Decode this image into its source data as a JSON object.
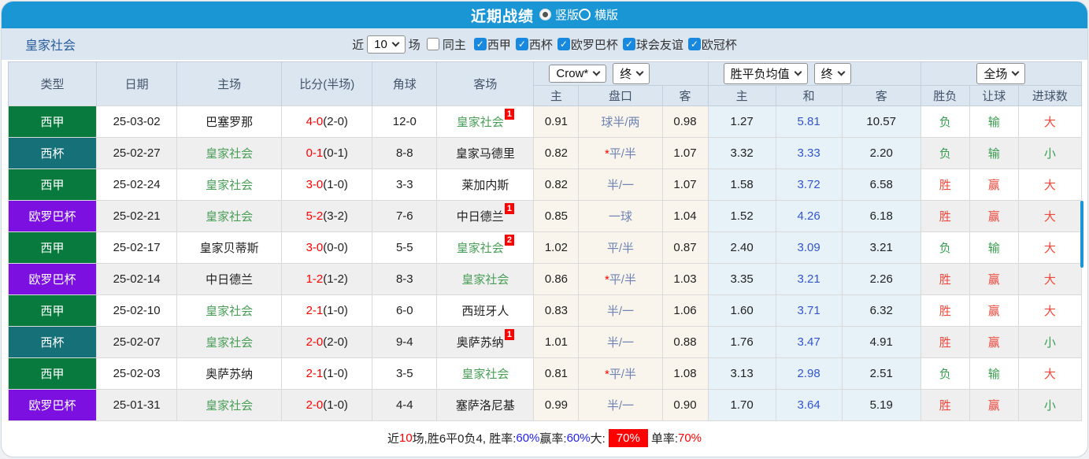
{
  "colors": {
    "accent": "#1b96d4",
    "check_blue": "#1989e0",
    "liga": "#087a3e",
    "copa": "#167078",
    "uefa": "#7b10e0",
    "team_green": "#4a9e58",
    "score_red": "#ff0000",
    "win_red": "#f0483c",
    "lose_green": "#3a9e50",
    "handicap_blue": "#6f83b5",
    "draw_blue": "#3355cc",
    "team_link_blue": "#2a5d9c",
    "footer_blue": "#2222ee"
  },
  "title_bar": {
    "title": "近期战绩",
    "radios": [
      {
        "label": "竖版",
        "checked": true
      },
      {
        "label": "横版",
        "checked": false
      }
    ]
  },
  "filter": {
    "team": "皇家社会",
    "near": "近",
    "count": "10",
    "matches": "场",
    "same_home": {
      "label": "同主",
      "checked": false
    },
    "leagues": [
      {
        "label": "西甲",
        "checked": true
      },
      {
        "label": "西杯",
        "checked": true
      },
      {
        "label": "欧罗巴杯",
        "checked": true
      },
      {
        "label": "球会友谊",
        "checked": true
      },
      {
        "label": "欧冠杯",
        "checked": true
      }
    ]
  },
  "table": {
    "selects": {
      "bookmaker": "Crow*",
      "final1": "终",
      "avg": "胜平负均值",
      "final2": "终",
      "scope": "全场"
    },
    "headers": {
      "type": "类型",
      "date": "日期",
      "home": "主场",
      "score": "比分(半场)",
      "corner": "角球",
      "away": "客场",
      "h": "主",
      "handicap": "盘口",
      "a": "客",
      "avg_h": "主",
      "avg_d": "和",
      "avg_a": "客",
      "wl": "胜负",
      "hcap": "让球",
      "goals": "进球数"
    },
    "rows": [
      {
        "league": "西甲",
        "lc": "liga",
        "date": "25-03-02",
        "home": "巴塞罗那",
        "ht": false,
        "score": "4-0",
        "half": "(2-0)",
        "corner": "12-0",
        "away": "皇家社会",
        "at": true,
        "sup": "1",
        "o1": "0.91",
        "star": false,
        "hcap": "球半/两",
        "o2": "0.98",
        "a1": "1.27",
        "a2": "5.81",
        "a3": "10.57",
        "r1": "负",
        "r1c": "g",
        "r2": "输",
        "r2c": "g",
        "r3": "大",
        "r3c": "r"
      },
      {
        "league": "西杯",
        "lc": "copa",
        "date": "25-02-27",
        "home": "皇家社会",
        "ht": true,
        "score": "0-1",
        "half": "(0-1)",
        "corner": "8-8",
        "away": "皇家马德里",
        "at": false,
        "sup": "",
        "o1": "0.82",
        "star": true,
        "hcap": "平/半",
        "o2": "1.07",
        "a1": "3.32",
        "a2": "3.33",
        "a3": "2.20",
        "r1": "负",
        "r1c": "g",
        "r2": "输",
        "r2c": "g",
        "r3": "小",
        "r3c": "g"
      },
      {
        "league": "西甲",
        "lc": "liga",
        "date": "25-02-24",
        "home": "皇家社会",
        "ht": true,
        "score": "3-0",
        "half": "(1-0)",
        "corner": "3-3",
        "away": "莱加内斯",
        "at": false,
        "sup": "",
        "o1": "0.82",
        "star": false,
        "hcap": "半/一",
        "o2": "1.07",
        "a1": "1.58",
        "a2": "3.72",
        "a3": "6.58",
        "r1": "胜",
        "r1c": "r",
        "r2": "赢",
        "r2c": "r",
        "r3": "大",
        "r3c": "r"
      },
      {
        "league": "欧罗巴杯",
        "lc": "uefa",
        "date": "25-02-21",
        "home": "皇家社会",
        "ht": true,
        "score": "5-2",
        "half": "(3-2)",
        "corner": "7-6",
        "away": "中日德兰",
        "at": false,
        "sup": "1",
        "o1": "0.85",
        "star": false,
        "hcap": "一球",
        "o2": "1.04",
        "a1": "1.52",
        "a2": "4.26",
        "a3": "6.18",
        "r1": "胜",
        "r1c": "r",
        "r2": "赢",
        "r2c": "r",
        "r3": "大",
        "r3c": "r"
      },
      {
        "league": "西甲",
        "lc": "liga",
        "date": "25-02-17",
        "home": "皇家贝蒂斯",
        "ht": false,
        "score": "3-0",
        "half": "(0-0)",
        "corner": "5-5",
        "away": "皇家社会",
        "at": true,
        "sup": "2",
        "o1": "1.02",
        "star": false,
        "hcap": "平/半",
        "o2": "0.87",
        "a1": "2.40",
        "a2": "3.09",
        "a3": "3.21",
        "r1": "负",
        "r1c": "g",
        "r2": "输",
        "r2c": "g",
        "r3": "大",
        "r3c": "r"
      },
      {
        "league": "欧罗巴杯",
        "lc": "uefa",
        "date": "25-02-14",
        "home": "中日德兰",
        "ht": false,
        "score": "1-2",
        "half": "(1-2)",
        "corner": "8-3",
        "away": "皇家社会",
        "at": true,
        "sup": "",
        "o1": "0.86",
        "star": true,
        "hcap": "平/半",
        "o2": "1.03",
        "a1": "3.35",
        "a2": "3.21",
        "a3": "2.26",
        "r1": "胜",
        "r1c": "r",
        "r2": "赢",
        "r2c": "r",
        "r3": "大",
        "r3c": "r"
      },
      {
        "league": "西甲",
        "lc": "liga",
        "date": "25-02-10",
        "home": "皇家社会",
        "ht": true,
        "score": "2-1",
        "half": "(1-0)",
        "corner": "6-0",
        "away": "西班牙人",
        "at": false,
        "sup": "",
        "o1": "0.83",
        "star": false,
        "hcap": "半/一",
        "o2": "1.06",
        "a1": "1.60",
        "a2": "3.71",
        "a3": "6.32",
        "r1": "胜",
        "r1c": "r",
        "r2": "赢",
        "r2c": "r",
        "r3": "大",
        "r3c": "r"
      },
      {
        "league": "西杯",
        "lc": "copa",
        "date": "25-02-07",
        "home": "皇家社会",
        "ht": true,
        "score": "2-0",
        "half": "(2-0)",
        "corner": "9-4",
        "away": "奥萨苏纳",
        "at": false,
        "sup": "1",
        "o1": "1.01",
        "star": false,
        "hcap": "半/一",
        "o2": "0.88",
        "a1": "1.76",
        "a2": "3.47",
        "a3": "4.91",
        "r1": "胜",
        "r1c": "r",
        "r2": "赢",
        "r2c": "r",
        "r3": "小",
        "r3c": "g"
      },
      {
        "league": "西甲",
        "lc": "liga",
        "date": "25-02-03",
        "home": "奥萨苏纳",
        "ht": false,
        "score": "2-1",
        "half": "(1-0)",
        "corner": "3-5",
        "away": "皇家社会",
        "at": true,
        "sup": "",
        "o1": "0.81",
        "star": true,
        "hcap": "平/半",
        "o2": "1.08",
        "a1": "3.13",
        "a2": "2.98",
        "a3": "2.51",
        "r1": "负",
        "r1c": "g",
        "r2": "输",
        "r2c": "g",
        "r3": "大",
        "r3c": "r"
      },
      {
        "league": "欧罗巴杯",
        "lc": "uefa",
        "date": "25-01-31",
        "home": "皇家社会",
        "ht": true,
        "score": "2-0",
        "half": "(1-0)",
        "corner": "4-4",
        "away": "塞萨洛尼基",
        "at": false,
        "sup": "",
        "o1": "0.99",
        "star": false,
        "hcap": "半/一",
        "o2": "0.90",
        "a1": "1.70",
        "a2": "3.64",
        "a3": "5.19",
        "r1": "胜",
        "r1c": "r",
        "r2": "赢",
        "r2c": "r",
        "r3": "小",
        "r3c": "g"
      }
    ]
  },
  "footer": {
    "segments": [
      {
        "t": "近",
        "s": "n"
      },
      {
        "t": "10",
        "s": "red"
      },
      {
        "t": "场,胜6平0负4, 胜率:",
        "s": "n"
      },
      {
        "t": "60%",
        "s": "blue"
      },
      {
        "t": " 赢率:",
        "s": "n"
      },
      {
        "t": "60%",
        "s": "blue"
      },
      {
        "t": " 大: ",
        "s": "n"
      },
      {
        "t": "70%",
        "s": "badge"
      },
      {
        "t": " 单率:",
        "s": "n"
      },
      {
        "t": "70%",
        "s": "red"
      }
    ]
  }
}
